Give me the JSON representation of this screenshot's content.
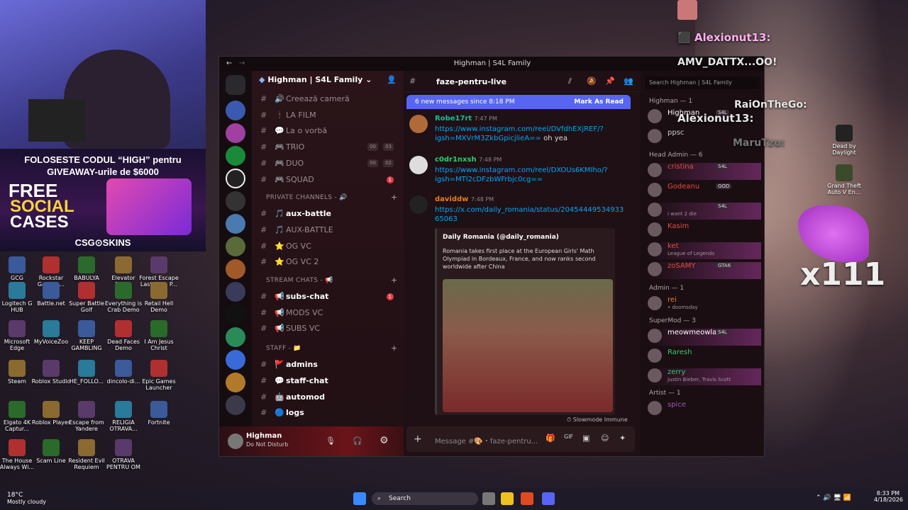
{
  "window": {
    "title": "Highman | S4L Family"
  },
  "server": {
    "name": "Highman | S4L Family"
  },
  "channels_top": [
    {
      "label": "Creează cameră",
      "icon": "🔊"
    },
    {
      "label": "LA FILM",
      "icon": "🕯"
    },
    {
      "label": "La o vorbă",
      "icon": "💬"
    },
    {
      "label": "TRIO",
      "icon": "🎮",
      "c1": "00",
      "c2": "03"
    },
    {
      "label": "DUO",
      "icon": "🎮",
      "c1": "00",
      "c2": "02"
    },
    {
      "label": "SQUAD",
      "icon": "🎮",
      "badge": "1"
    }
  ],
  "cat_private": "PRIVATE CHANNELS - 🔊",
  "private": [
    {
      "label": "aux-battle",
      "icon": "🎵",
      "bold": true
    },
    {
      "label": "AUX-BATTLE",
      "icon": "🎵"
    },
    {
      "label": "OG VC",
      "icon": "⭐"
    },
    {
      "label": "OG VC 2",
      "icon": "⭐"
    }
  ],
  "cat_stream": "STREAM CHATS - 📢",
  "stream": [
    {
      "label": "subs-chat",
      "icon": "📢",
      "badge": "1",
      "bold": true
    },
    {
      "label": "MODS VC",
      "icon": "📢"
    },
    {
      "label": "SUBS VC",
      "icon": "📢"
    }
  ],
  "cat_staff": "STAFF - 📁",
  "staff": [
    {
      "label": "admins",
      "icon": "🚩",
      "bold": true
    },
    {
      "label": "staff-chat",
      "icon": "💬",
      "bold": true
    },
    {
      "label": "automod",
      "icon": "🤖",
      "bold": true
    },
    {
      "label": "logs",
      "icon": "🔵",
      "bold": true
    }
  ],
  "user": {
    "name": "Highman",
    "status": "Do Not Disturb"
  },
  "chat": {
    "channel": "faze-pentru-live",
    "new_banner": "6 new messages since 8:18 PM",
    "mark_read": "Mark As Read",
    "search_placeholder": "Search Highman | S4L Family",
    "input_placeholder": "Message #🎨・faze-pentru...",
    "slowmode": "Slowmode Immune",
    "messages": [
      {
        "author": "Robe17rt",
        "time": "7:47 PM",
        "color": "#1abc9c",
        "text": "https://www.instagram.com/reel/DVfdhEXjREF/?igsh=MXVrM3ZkbGpicjlieA==",
        "suffix": "oh yea"
      },
      {
        "author": "c0dr1nxsh",
        "time": "7:48 PM",
        "color": "#2ecc71",
        "text": "https://www.instagram.com/reel/DXOUs6KMIho/?igsh=MTl2cDFzbWFrbjc0cg=="
      },
      {
        "author": "daviddw",
        "time": "7:48 PM",
        "color": "#e67e22",
        "text": "https://x.com/daily_romania/status/2045444953493365063"
      }
    ],
    "embed": {
      "source": "Daily Romania (@daily_romania)",
      "body": "Romania takes first place at the European Girls' Math Olympiad in Bordeaux, France, and now ranks second worldwide after China"
    }
  },
  "members": {
    "highman_cat": "Highman — 1",
    "online": [
      {
        "name": "Highman",
        "tag": "S4L",
        "color": "#ffffff"
      },
      {
        "name": "ppsc",
        "color": "#cccccc"
      }
    ],
    "cat_head": "Head Admin — 6",
    "head": [
      {
        "name": "cristina",
        "tag": "S4L",
        "color": "#e74c3c"
      },
      {
        "name": "Godeanu",
        "tag": "GOD",
        "color": "#e74c3c"
      },
      {
        "name": "",
        "tag": "S4L",
        "sub": "i want 2 die",
        "color": "#e74c3c"
      },
      {
        "name": "Kasim",
        "color": "#e74c3c"
      },
      {
        "name": "ket",
        "sub": "League of Legends",
        "color": "#e74c3c"
      },
      {
        "name": "zoSAMY",
        "tag": "GTA6",
        "color": "#e74c3c"
      }
    ],
    "cat_admin": "Admin — 1",
    "admin": [
      {
        "name": "rei",
        "sub": "• doomsday",
        "color": "#e67e22"
      }
    ],
    "cat_super": "SuperMod — 3",
    "super": [
      {
        "name": "meowmeowlas...",
        "tag": "S4L",
        "color": "#ffffff"
      },
      {
        "name": "Raresh",
        "color": "#2ecc71"
      },
      {
        "name": "zerry",
        "sub": "Justin Bieber, Travis Scott",
        "color": "#2ecc71"
      }
    ],
    "cat_artist": "Artist — 1",
    "artist": [
      {
        "name": "spice",
        "color": "#9b59b6"
      }
    ]
  },
  "webcam": {
    "line1": "FOLOSESTE CODUL “HIGH” pentru",
    "line2": "GIVEAWAY-urile de $6000",
    "free": "FREE",
    "social": "SOCIAL",
    "cases": "CASES",
    "brand": "CSG⊙SKINS"
  },
  "overlay": {
    "a": "Alexionut13:",
    "b": "AMV_DATTX...OO!",
    "c": "RaiOnTheGo:",
    "d": "Alexionut13:",
    "e": "MaruTzu:",
    "x": "x111"
  },
  "desktop_icons": [
    {
      "label": "GCG",
      "col": 0,
      "row": 0
    },
    {
      "label": "Rockstar Games ...",
      "col": 1,
      "row": 0
    },
    {
      "label": "BABULYA",
      "col": 2,
      "row": 0
    },
    {
      "label": "Elevator Demo",
      "col": 3,
      "row": 0
    },
    {
      "label": "Forest Escape Last Train P...",
      "col": 4,
      "row": 0
    },
    {
      "label": "Logitech G HUB",
      "col": 0,
      "row": 1
    },
    {
      "label": "Battle.net",
      "col": 1,
      "row": 1
    },
    {
      "label": "Super Battle Golf",
      "col": 2,
      "row": 1
    },
    {
      "label": "Everything is Crab Demo",
      "col": 3,
      "row": 1
    },
    {
      "label": "Retail Hell Demo",
      "col": 4,
      "row": 1
    },
    {
      "label": "Microsoft Edge",
      "col": 0,
      "row": 2
    },
    {
      "label": "MyVoiceZoo",
      "col": 1,
      "row": 2
    },
    {
      "label": "KEEP GAMBLING",
      "col": 2,
      "row": 2
    },
    {
      "label": "Dead Faces Demo",
      "col": 3,
      "row": 2
    },
    {
      "label": "I Am Jesus Christ",
      "col": 4,
      "row": 2
    },
    {
      "label": "Steam",
      "col": 0,
      "row": 3
    },
    {
      "label": "Roblox Studio",
      "col": 1,
      "row": 3
    },
    {
      "label": "HE_FOLLO...",
      "col": 2,
      "row": 3
    },
    {
      "label": "dincolo-di...",
      "col": 3,
      "row": 3
    },
    {
      "label": "Epic Games Launcher",
      "col": 4,
      "row": 3
    },
    {
      "label": "Elgato 4K Captur...",
      "col": 0,
      "row": 4
    },
    {
      "label": "Roblox Player",
      "col": 1,
      "row": 4
    },
    {
      "label": "Escape from Yandere",
      "col": 2,
      "row": 4
    },
    {
      "label": "RELIGIA OTRAVA...",
      "col": 3,
      "row": 4
    },
    {
      "label": "Fortnite",
      "col": 4,
      "row": 4
    },
    {
      "label": "The House Always Wi...",
      "col": 0,
      "row": 5
    },
    {
      "label": "Scam Line",
      "col": 1,
      "row": 5
    },
    {
      "label": "Resident Evil Requiem",
      "col": 2,
      "row": 5
    },
    {
      "label": "OTRAVA PENTRU OM",
      "col": 3,
      "row": 5
    }
  ],
  "right_icons": [
    {
      "label": "Dead by Daylight"
    },
    {
      "label": "Grand Theft Auto V En..."
    }
  ],
  "taskbar": {
    "search": "Search",
    "time": "8:33 PM",
    "date": "4/18/2026",
    "temp": "18°C",
    "weather": "Mostly cloudy"
  }
}
